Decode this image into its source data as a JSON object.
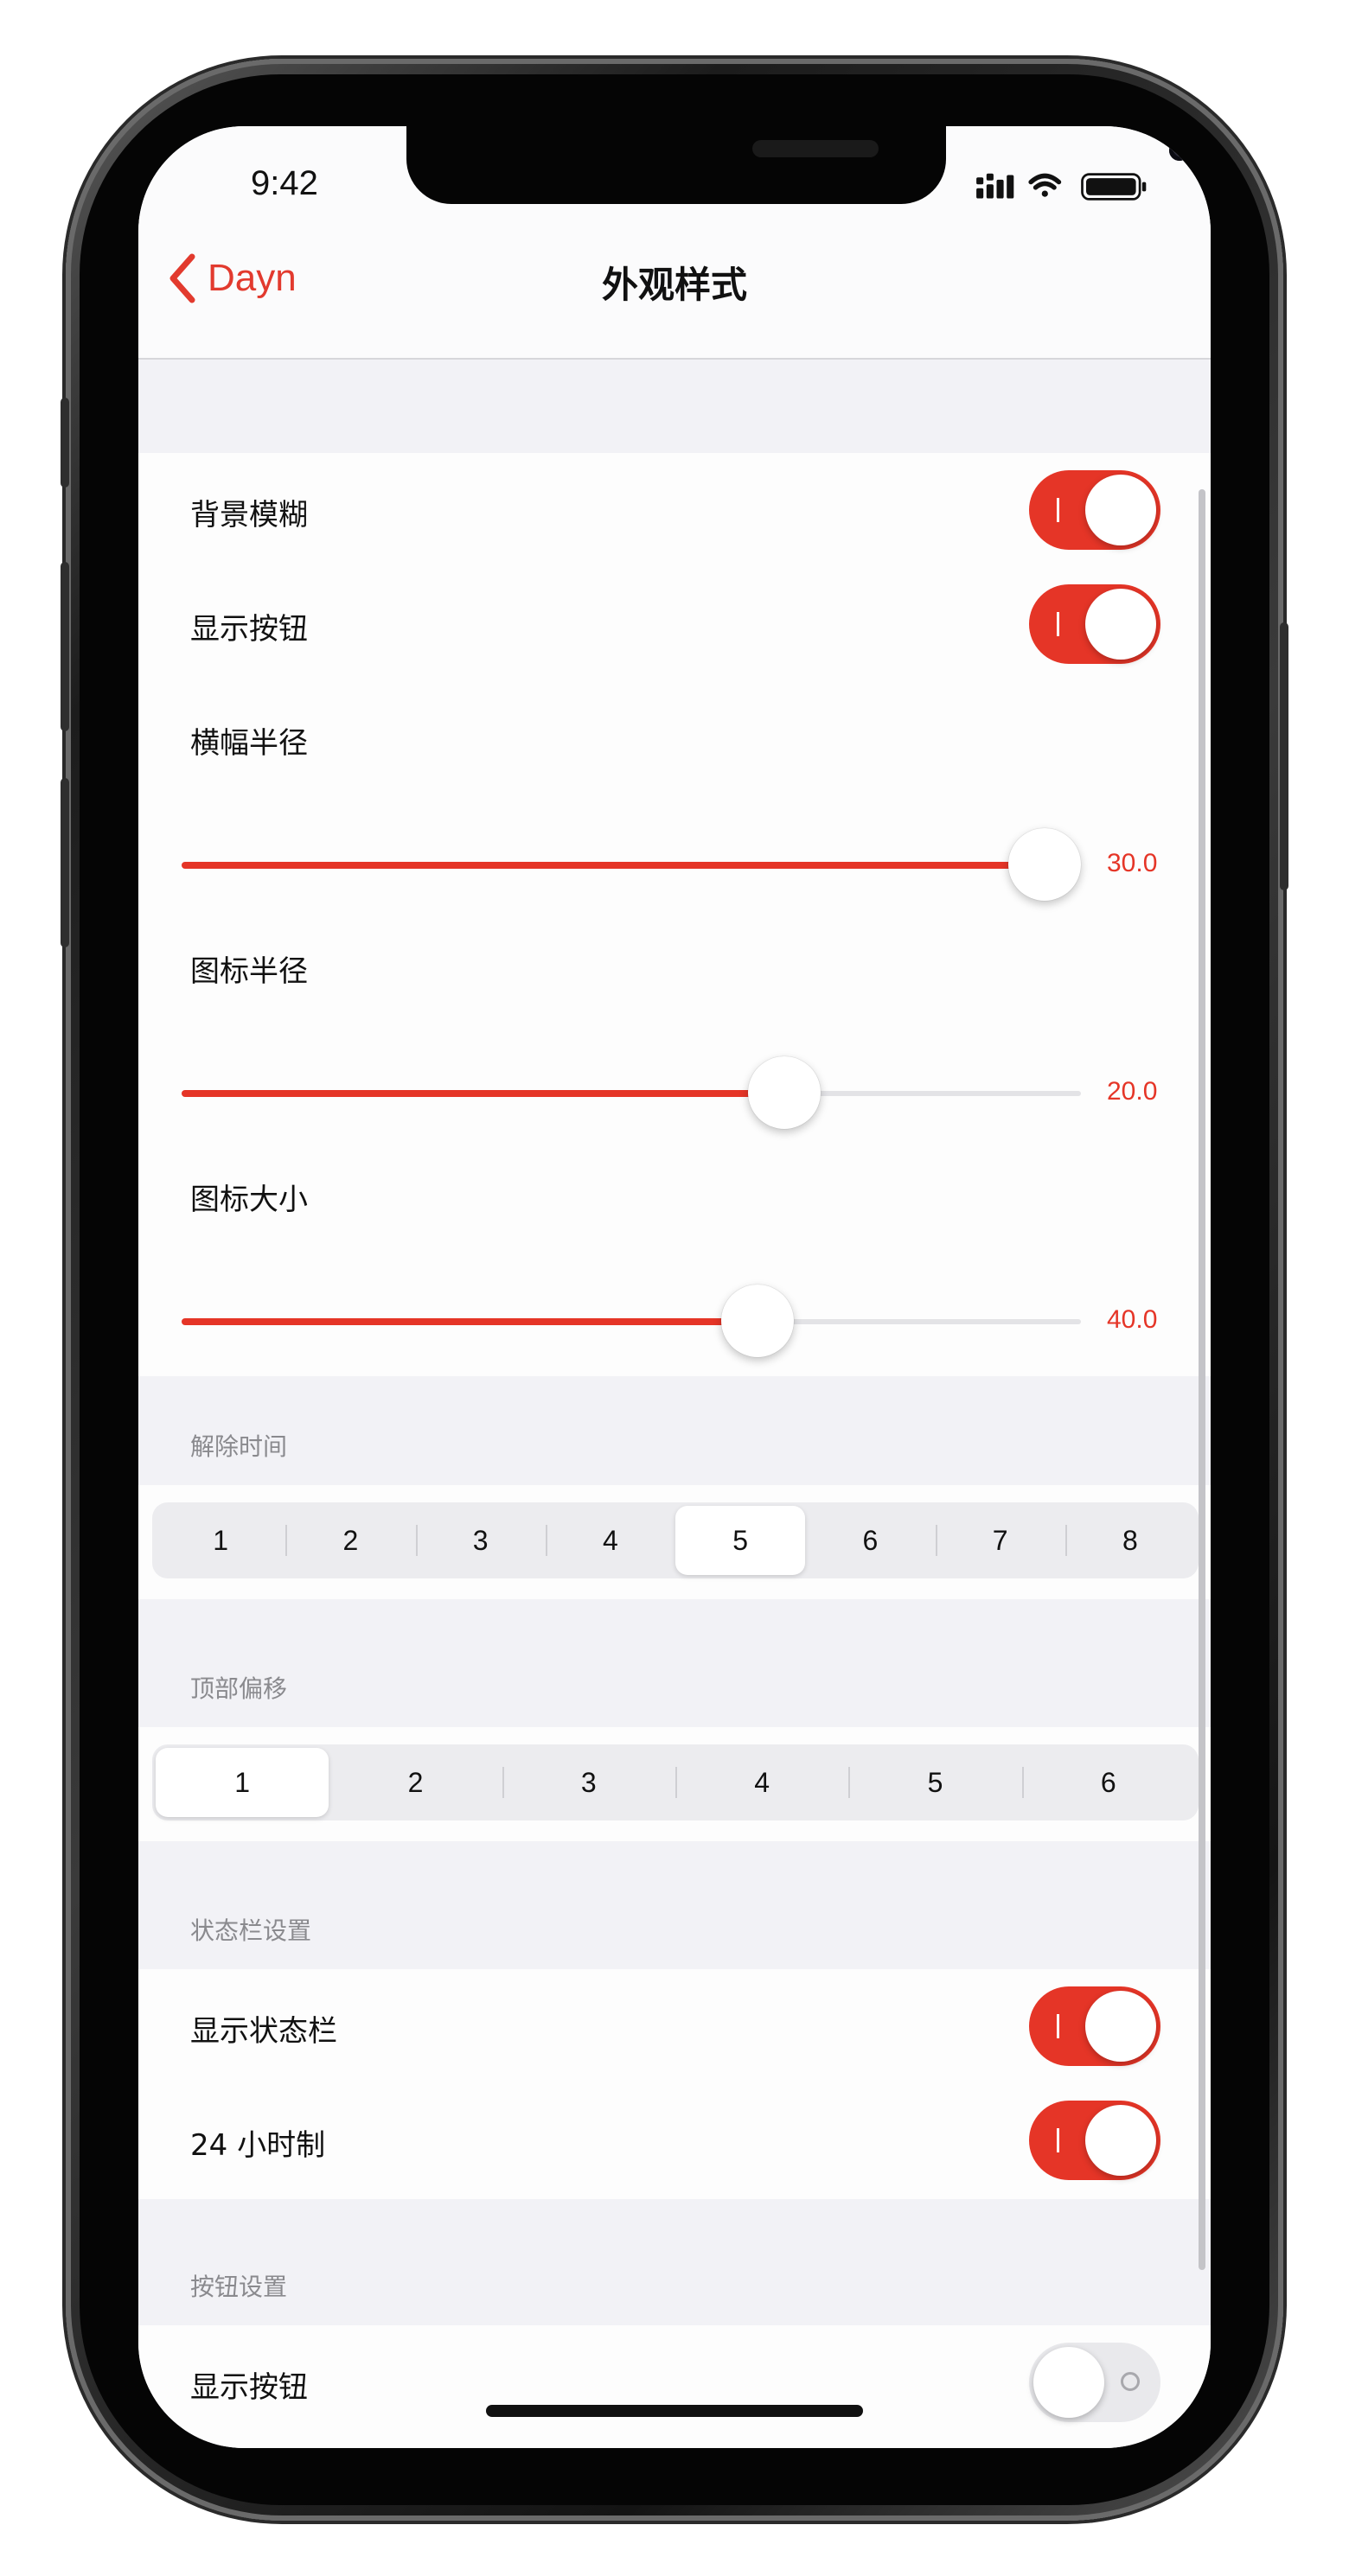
{
  "status_bar": {
    "time": "9:42",
    "icons": [
      "cellular-signal-icon",
      "wifi-icon",
      "battery-icon"
    ]
  },
  "nav": {
    "back_label": "Dayn",
    "title": "外观样式"
  },
  "group1": {
    "background_blur": {
      "label": "背景模糊",
      "on": true
    },
    "show_buttons": {
      "label": "显示按钮",
      "on": true
    },
    "banner_radius": {
      "label": "横幅半径",
      "value_text": "30.0",
      "fill_fraction": 1.0
    },
    "icon_radius": {
      "label": "图标半径",
      "value_text": "20.0",
      "fill_fraction": 0.67
    },
    "icon_size": {
      "label": "图标大小",
      "value_text": "40.0",
      "fill_fraction": 0.64
    }
  },
  "dismiss_time": {
    "header": "解除时间",
    "options": [
      "1",
      "2",
      "3",
      "4",
      "5",
      "6",
      "7",
      "8"
    ],
    "selected": "5"
  },
  "top_offset": {
    "header": "顶部偏移",
    "options": [
      "1",
      "2",
      "3",
      "4",
      "5",
      "6"
    ],
    "selected": "1"
  },
  "status_bar_settings": {
    "header": "状态栏设置",
    "show_status_bar": {
      "label": "显示状态栏",
      "on": true
    },
    "twenty_four_hour": {
      "label": "24 小时制",
      "on": true
    }
  },
  "button_settings": {
    "header": "按钮设置",
    "show_buttons": {
      "label": "显示按钮",
      "on": false
    }
  },
  "colors": {
    "accent": "#e53527",
    "background": "#f2f2f6",
    "cell": "#fdfdfd"
  }
}
